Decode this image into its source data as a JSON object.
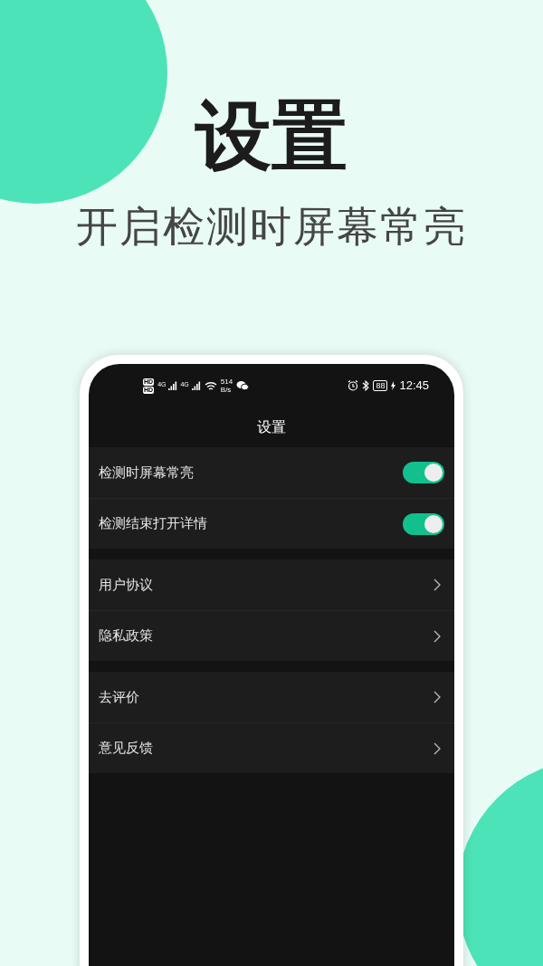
{
  "headline": "设置",
  "subtitle": "开启检测时屏幕常亮",
  "status_bar": {
    "hd_labels": [
      "HD",
      "HD"
    ],
    "network_labels": [
      "4G",
      "4G"
    ],
    "speed_value": "514",
    "speed_unit": "B/s",
    "battery": "88",
    "time": "12:45"
  },
  "screen_title": "设置",
  "groups": [
    {
      "items": [
        {
          "kind": "toggle",
          "label": "检测时屏幕常亮",
          "on": true
        },
        {
          "kind": "toggle",
          "label": "检测结束打开详情",
          "on": true
        }
      ]
    },
    {
      "items": [
        {
          "kind": "link",
          "label": "用户协议"
        },
        {
          "kind": "link",
          "label": "隐私政策"
        }
      ]
    },
    {
      "items": [
        {
          "kind": "link",
          "label": "去评价"
        },
        {
          "kind": "link",
          "label": "意见反馈"
        }
      ]
    }
  ]
}
